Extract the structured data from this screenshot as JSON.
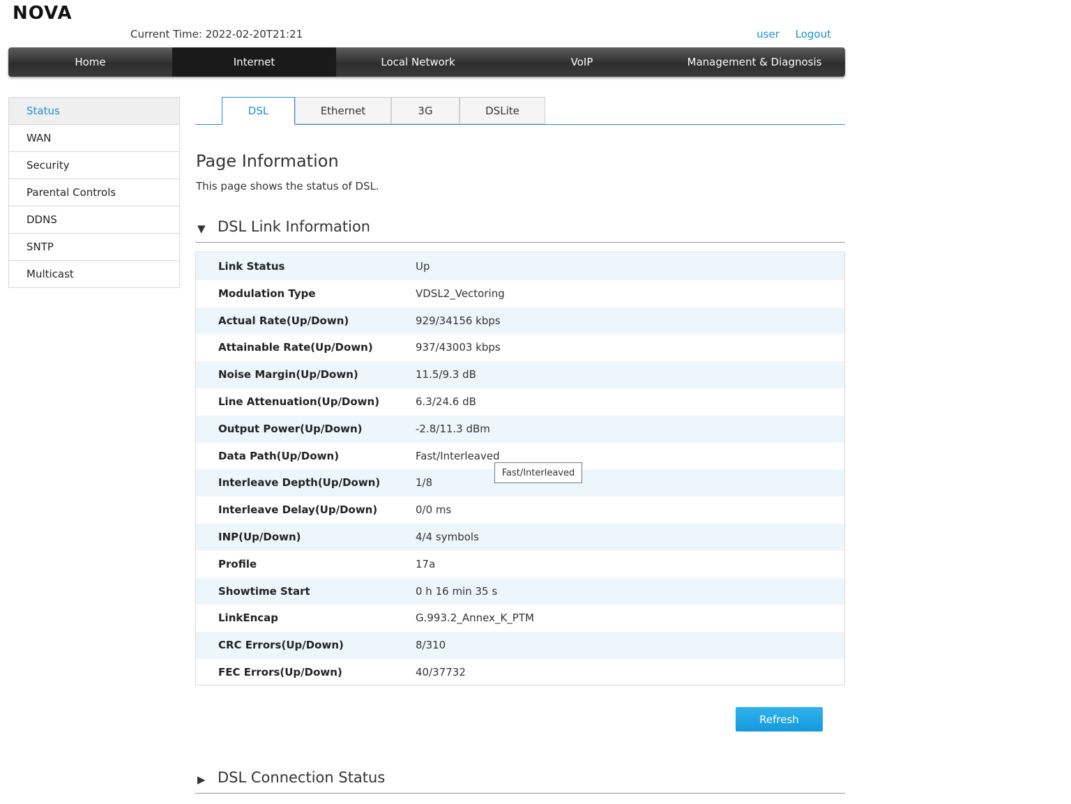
{
  "brand": {
    "logo": "NOVA"
  },
  "header": {
    "current_time": "Current Time: 2022-02-20T21:21",
    "user_link": "user",
    "logout_link": "Logout"
  },
  "nav": {
    "items": [
      {
        "label": "Home"
      },
      {
        "label": "Internet"
      },
      {
        "label": "Local Network"
      },
      {
        "label": "VoIP"
      },
      {
        "label": "Management & Diagnosis"
      }
    ],
    "active": "Internet"
  },
  "sidebar": {
    "items": [
      {
        "label": "Status"
      },
      {
        "label": "WAN"
      },
      {
        "label": "Security"
      },
      {
        "label": "Parental Controls"
      },
      {
        "label": "DDNS"
      },
      {
        "label": "SNTP"
      },
      {
        "label": "Multicast"
      }
    ],
    "active": "Status"
  },
  "tabs": {
    "items": [
      {
        "label": "DSL"
      },
      {
        "label": "Ethernet"
      },
      {
        "label": "3G"
      },
      {
        "label": "DSLite"
      }
    ],
    "active": "DSL"
  },
  "page": {
    "title": "Page Information",
    "description": "This page shows the status of DSL."
  },
  "dsl_link": {
    "section_title": "DSL Link Information",
    "expanded_icon": "▼",
    "rows": [
      {
        "label": "Link Status",
        "value": "Up"
      },
      {
        "label": "Modulation Type",
        "value": "VDSL2_Vectoring"
      },
      {
        "label": "Actual Rate(Up/Down)",
        "value": "929/34156 kbps"
      },
      {
        "label": "Attainable Rate(Up/Down)",
        "value": "937/43003 kbps"
      },
      {
        "label": "Noise Margin(Up/Down)",
        "value": "11.5/9.3 dB"
      },
      {
        "label": "Line Attenuation(Up/Down)",
        "value": "6.3/24.6 dB"
      },
      {
        "label": "Output Power(Up/Down)",
        "value": "-2.8/11.3 dBm"
      },
      {
        "label": "Data Path(Up/Down)",
        "value": "Fast/Interleaved"
      },
      {
        "label": "Interleave Depth(Up/Down)",
        "value": "1/8"
      },
      {
        "label": "Interleave Delay(Up/Down)",
        "value": "0/0 ms"
      },
      {
        "label": "INP(Up/Down)",
        "value": "4/4 symbols"
      },
      {
        "label": "Profile",
        "value": "17a"
      },
      {
        "label": "Showtime Start",
        "value": "0 h 16 min 35 s"
      },
      {
        "label": "LinkEncap",
        "value": "G.993.2_Annex_K_PTM"
      },
      {
        "label": "CRC Errors(Up/Down)",
        "value": "8/310"
      },
      {
        "label": "FEC Errors(Up/Down)",
        "value": "40/37732"
      }
    ],
    "tooltip": "Fast/Interleaved"
  },
  "buttons": {
    "refresh": "Refresh"
  },
  "dsl_connection": {
    "section_title": "DSL Connection Status",
    "collapsed_icon": "▶"
  },
  "colors": {
    "accent": "#1a8fd8",
    "button": "#1499dc",
    "row_alt": "#eef6fd"
  }
}
